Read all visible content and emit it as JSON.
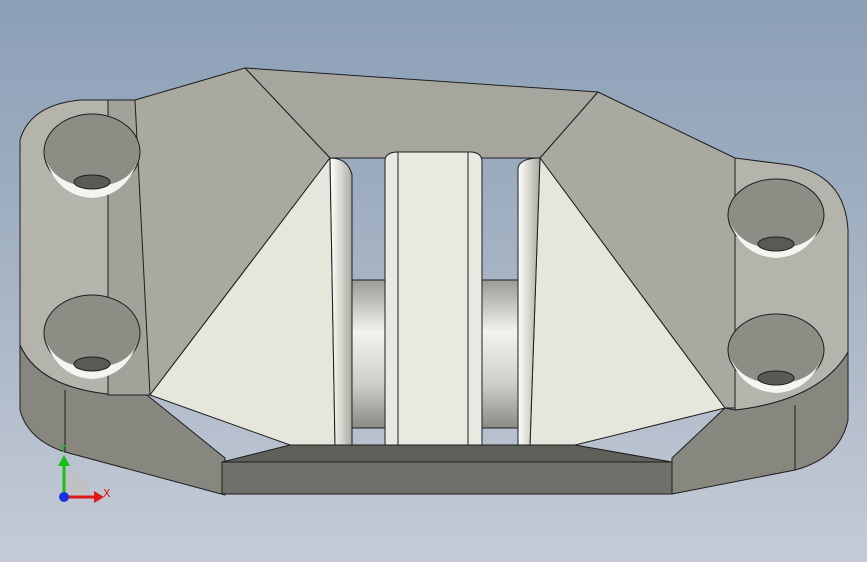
{
  "triad": {
    "x_label": "X",
    "y_label": "Y",
    "x_color": "#e01818",
    "y_color": "#18c018",
    "z_color": "#1830e0"
  },
  "colors": {
    "background_top": "#8b9fb6",
    "background_bottom": "#c5cbd6",
    "face_light": "#e6e6dc",
    "face_mid": "#b9b9b2",
    "face_dark": "#8b8b84",
    "face_darkest": "#6f706a",
    "edge": "#1e1e1e"
  }
}
